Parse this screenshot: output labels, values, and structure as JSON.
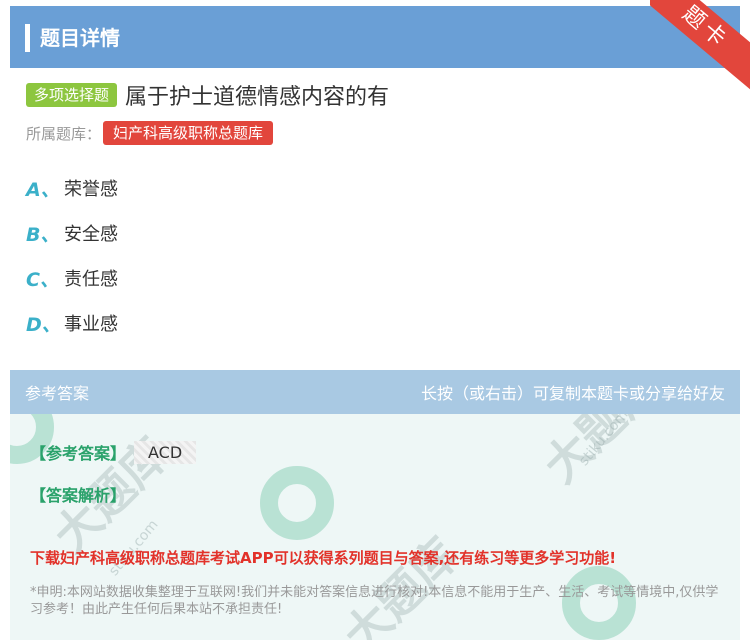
{
  "header": {
    "title": "题目详情"
  },
  "ribbon": {
    "label": "题卡"
  },
  "question": {
    "type_badge": "多项选择题",
    "text": "属于护士道德情感内容的有"
  },
  "bank": {
    "label": "所属题库：",
    "name": "妇产科高级职称总题库"
  },
  "options": [
    {
      "letter": "A、",
      "text": "荣誉感"
    },
    {
      "letter": "B、",
      "text": "安全感"
    },
    {
      "letter": "C、",
      "text": "责任感"
    },
    {
      "letter": "D、",
      "text": "事业感"
    }
  ],
  "answer_panel": {
    "title": "参考答案",
    "hint": "长按（或右击）可复制本题卡或分享给好友",
    "answer_label": "【参考答案】",
    "answer_value": "ACD",
    "analysis_label": "【答案解析】",
    "download_text": "下载妇产科高级职称总题库考试APP可以获得系列题目与答案,还有练习等更多学习功能!",
    "disclaimer": "*申明:本网站数据收集整理于互联网!我们并未能对答案信息进行核对!本信息不能用于生产、生活、考试等情境中,仅供学习参考！由此产生任何后果本站不承担责任!"
  },
  "colors": {
    "header_bg": "#6a9fd6",
    "ribbon_bg": "#e2463c",
    "type_badge_bg": "#8dc63f",
    "bank_tag_bg": "#e2463c",
    "option_letter": "#3bb0c9",
    "answer_label": "#2aa26b",
    "download_text": "#e2322a"
  }
}
